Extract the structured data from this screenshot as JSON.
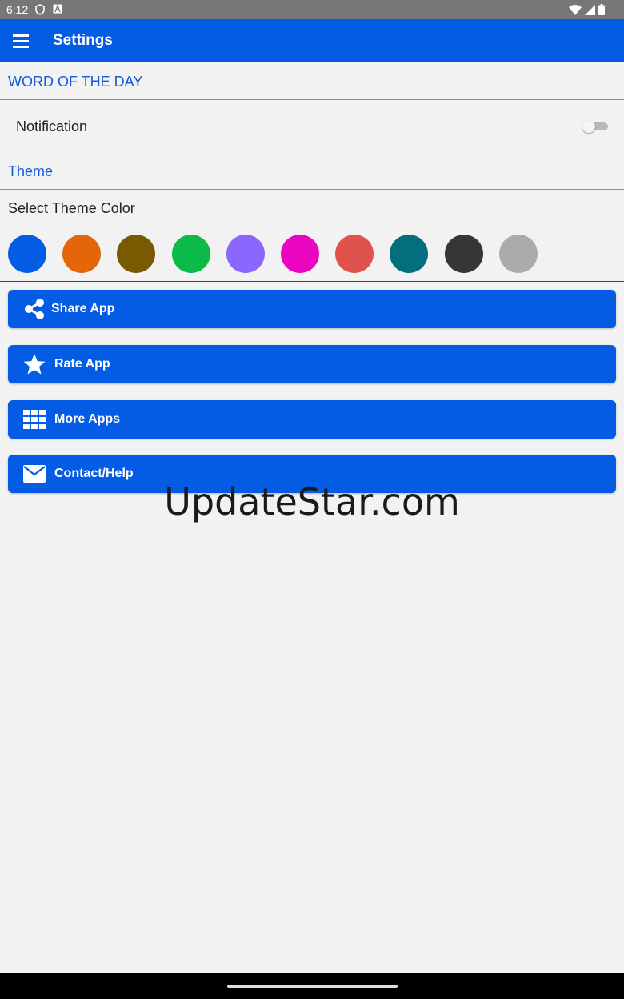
{
  "status_bar": {
    "time": "6:12"
  },
  "app_bar": {
    "title": "Settings"
  },
  "word_of_the_day": {
    "header": "WORD OF THE DAY",
    "notification_label": "Notification",
    "notification_enabled": false
  },
  "theme": {
    "header": "Theme",
    "select_label": "Select Theme Color",
    "colors": [
      "#055ce4",
      "#e5650a",
      "#7a5a00",
      "#0cba48",
      "#8b66ff",
      "#ea06c0",
      "#e0534c",
      "#046f7c",
      "#363636",
      "#ababab"
    ]
  },
  "actions": {
    "share_label": "Share App",
    "rate_label": "Rate App",
    "more_label": "More Apps",
    "contact_label": "Contact/Help"
  },
  "watermark": "UpdateStar.com",
  "colors": {
    "primary": "#055ce4",
    "accent_text": "#1759d6",
    "background": "#f2f2f2"
  }
}
